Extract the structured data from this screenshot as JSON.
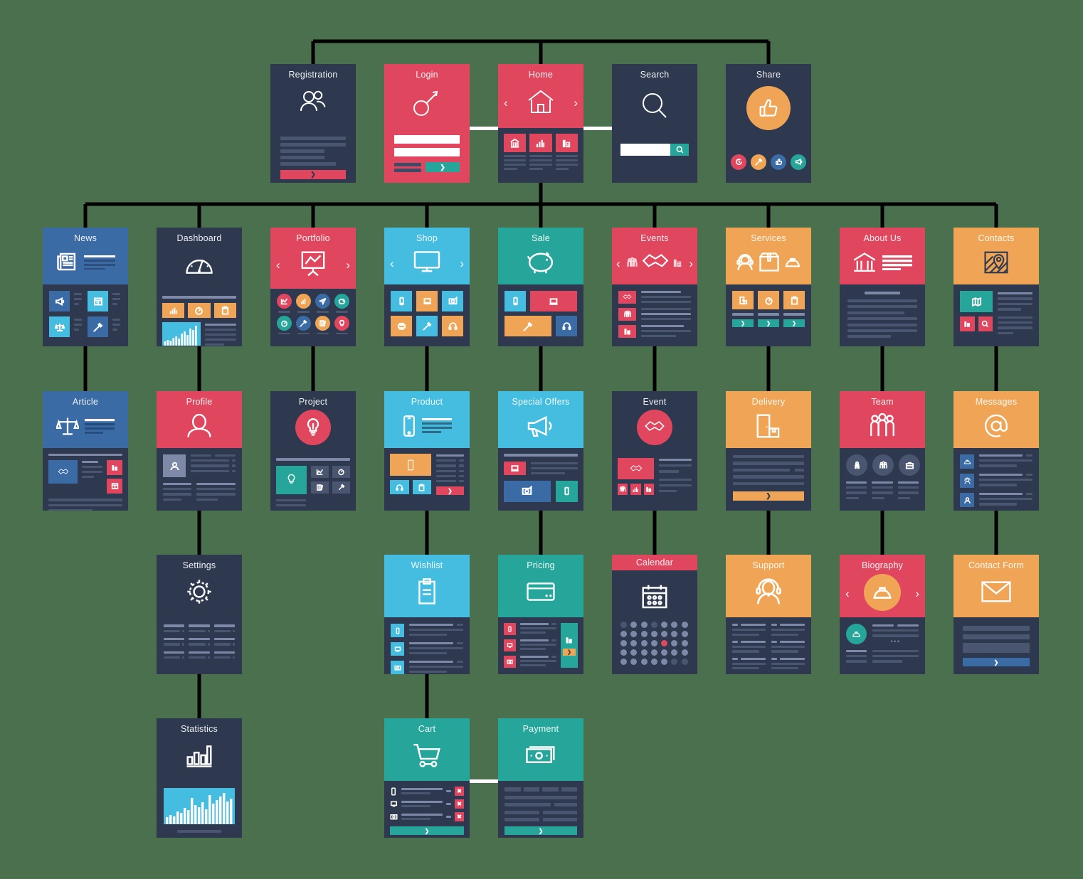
{
  "diagram": {
    "type": "sitemap",
    "background_color": "#4a704d",
    "connector_color": "#000000",
    "white_connector_color": "#ffffff",
    "palette": {
      "dark_navy": "#2e3950",
      "red": "#e0475e",
      "blue": "#3a6ba5",
      "light_blue": "#45bde0",
      "teal": "#26a69a",
      "orange": "#efa555",
      "body_navy": "#2e3950",
      "bar": "#4a5570",
      "bar_light": "#7d89a6"
    }
  },
  "rows": [
    {
      "name": "row-1",
      "cards": [
        {
          "id": "registration",
          "label": "Registration",
          "header_color": "#2e3950",
          "icon": "users-icon",
          "body": "text-lines-with-red-button",
          "button_color": "#e0475e",
          "button_glyph": "❯"
        },
        {
          "id": "login",
          "label": "Login",
          "header_color": "#e0475e",
          "icon": "key-icon",
          "body": "two-white-input-fields-and-teal-submit",
          "button_color": "#26a69a",
          "button_glyph": "❯"
        },
        {
          "id": "home",
          "label": "Home",
          "header_color": "#e0475e",
          "icon": "house-icon",
          "arrows": true,
          "body": "three-red-tiles-with-text",
          "tiles": [
            "bank-icon",
            "bar-chart-icon",
            "building-icon"
          ]
        },
        {
          "id": "search",
          "label": "Search",
          "header_color": "#2e3950",
          "icon": "magnifier-icon",
          "body": "white-search-field-with-teal-search-button",
          "button_color": "#26a69a"
        },
        {
          "id": "share",
          "label": "Share",
          "header_color": "#2e3950",
          "icon": "thumbs-up-icon",
          "icon_circle_color": "#efa555",
          "social": [
            {
              "name": "clock-icon",
              "color": "#e0475e"
            },
            {
              "name": "pen-icon",
              "color": "#efa555"
            },
            {
              "name": "thumbs-up-icon",
              "color": "#3a6ba5"
            },
            {
              "name": "megaphone-icon",
              "color": "#26a69a"
            }
          ]
        }
      ]
    },
    {
      "name": "row-2",
      "cards": [
        {
          "id": "news",
          "label": "News",
          "header_color": "#3a6ba5",
          "icon": "newspaper-icon",
          "body": "four-tiles-with-text-lines",
          "tiles": [
            {
              "name": "megaphone-icon",
              "color": "#3a6ba5"
            },
            {
              "name": "layout-icon",
              "color": "#45bde0"
            },
            {
              "name": "scales-icon",
              "color": "#45bde0"
            },
            {
              "name": "pen-icon",
              "color": "#3a6ba5"
            }
          ]
        },
        {
          "id": "dashboard",
          "label": "Dashboard",
          "header_color": "#2e3950",
          "icon": "gauge-icon",
          "body": "three-orange-tiles-and-chart",
          "tiles": [
            {
              "name": "bar-chart-icon",
              "color": "#efa555"
            },
            {
              "name": "compass-icon",
              "color": "#efa555"
            },
            {
              "name": "clipboard-icon",
              "color": "#efa555"
            }
          ],
          "chart_color": "#45bde0"
        },
        {
          "id": "portfolio",
          "label": "Portfolio",
          "header_color": "#e0475e",
          "icon": "presentation-chart-icon",
          "arrows": true,
          "body": "eight-circle-icons",
          "circles": [
            {
              "name": "chart-icon",
              "color": "#e0475e"
            },
            {
              "name": "bar-chart-icon",
              "color": "#efa555"
            },
            {
              "name": "paper-plane-icon",
              "color": "#3a6ba5"
            },
            {
              "name": "piggy-bank-icon",
              "color": "#26a69a"
            },
            {
              "name": "compass-icon",
              "color": "#26a69a"
            },
            {
              "name": "pen-icon",
              "color": "#3a6ba5"
            },
            {
              "name": "books-icon",
              "color": "#efa555"
            },
            {
              "name": "bulb-icon",
              "color": "#e0475e"
            }
          ]
        },
        {
          "id": "shop",
          "label": "Shop",
          "header_color": "#45bde0",
          "icon": "monitor-icon",
          "arrows": true,
          "body": "six-product-tiles",
          "tiles": [
            {
              "name": "phone-icon",
              "color": "#45bde0"
            },
            {
              "name": "laptop-icon",
              "color": "#efa555"
            },
            {
              "name": "camera-icon",
              "color": "#45bde0"
            },
            {
              "name": "printer-icon",
              "color": "#efa555"
            },
            {
              "name": "pen-icon",
              "color": "#45bde0"
            },
            {
              "name": "headphones-icon",
              "color": "#efa555"
            }
          ]
        },
        {
          "id": "sale",
          "label": "Sale",
          "header_color": "#26a69a",
          "icon": "piggy-bank-icon",
          "body": "four-sale-tiles",
          "tiles": [
            {
              "name": "phone-icon",
              "color": "#45bde0"
            },
            {
              "name": "laptop-icon",
              "color": "#e0475e"
            },
            {
              "name": "pen-icon",
              "color": "#efa555"
            },
            {
              "name": "headphones-icon",
              "color": "#3a6ba5"
            }
          ]
        },
        {
          "id": "events",
          "label": "Events",
          "header_color": "#e0475e",
          "icon": "handshake-icon",
          "arrows": true,
          "header_extra_icons": [
            "group-icon",
            "building-icon"
          ],
          "body": "three-red-thumbs-with-lines",
          "tiles": [
            {
              "name": "handshake-icon",
              "color": "#e0475e"
            },
            {
              "name": "group-icon",
              "color": "#e0475e"
            },
            {
              "name": "building-icon",
              "color": "#e0475e"
            }
          ]
        },
        {
          "id": "services",
          "label": "Services",
          "header_color": "#efa555",
          "header_icons": [
            "headset-icon",
            "box-icon",
            "helmet-icon"
          ],
          "body": "three-orange-tiles-with-teal-buttons",
          "tiles": [
            {
              "name": "door-box-icon",
              "color": "#efa555"
            },
            {
              "name": "compass-icon",
              "color": "#efa555"
            },
            {
              "name": "clipboard-icon",
              "color": "#efa555"
            }
          ],
          "button_color": "#26a69a",
          "button_glyph": "❯"
        },
        {
          "id": "about-us",
          "label": "About Us",
          "header_color": "#e0475e",
          "header_icons": [
            "bank-icon",
            "text-lines-icon"
          ],
          "body": "paragraph-lines"
        },
        {
          "id": "contacts",
          "label": "Contacts",
          "header_color": "#efa555",
          "icon": "map-pin-icon",
          "body": "map-tile-and-two-red-tiles",
          "tiles": [
            {
              "name": "map-icon",
              "color": "#26a69a"
            },
            {
              "name": "building-icon",
              "color": "#e0475e"
            },
            {
              "name": "magnifier-icon",
              "color": "#e0475e"
            }
          ]
        }
      ]
    },
    {
      "name": "row-3",
      "cards": [
        {
          "id": "article",
          "label": "Article",
          "header_color": "#3a6ba5",
          "header_icons": [
            "scales-icon",
            "text-lines-icon"
          ],
          "body": "image-tile-with-two-red-tiles",
          "tiles": [
            {
              "name": "handshake-icon",
              "color": "#3a6ba5"
            },
            {
              "name": "building-icon",
              "color": "#e0475e"
            },
            {
              "name": "layout-icon",
              "color": "#e0475e"
            }
          ]
        },
        {
          "id": "profile",
          "label": "Profile",
          "header_color": "#e0475e",
          "icon": "person-icon",
          "body": "avatar-with-text-lines",
          "tiles": [
            {
              "name": "person-icon",
              "color": "#7d89a6"
            }
          ]
        },
        {
          "id": "project",
          "label": "Project",
          "header_color": "#2e3950",
          "icon": "bulb-icon",
          "icon_circle_color": "#e0475e",
          "body": "four-tiles-with-lines",
          "tiles": [
            {
              "name": "bulb-icon",
              "color": "#26a69a"
            },
            {
              "name": "chart-icon",
              "color": "#4a5570"
            },
            {
              "name": "books-icon",
              "color": "#4a5570"
            },
            {
              "name": "pen-icon",
              "color": "#4a5570"
            }
          ]
        },
        {
          "id": "product",
          "label": "Product",
          "header_color": "#45bde0",
          "header_icons": [
            "phone-icon",
            "text-lines-icon"
          ],
          "body": "orange-image-tile-with-spec-list",
          "tiles": [
            {
              "name": "phone-icon",
              "color": "#efa555"
            },
            {
              "name": "headphones-icon",
              "color": "#45bde0"
            },
            {
              "name": "clipboard-icon",
              "color": "#45bde0"
            }
          ],
          "button_color": "#e0475e",
          "button_glyph": "❯"
        },
        {
          "id": "special-offers",
          "label": "Special Offers",
          "header_color": "#45bde0",
          "icon": "megaphone-icon",
          "body": "offer-tiles",
          "tiles": [
            {
              "name": "laptop-icon",
              "color": "#e0475e"
            },
            {
              "name": "camera-icon",
              "color": "#3a6ba5"
            },
            {
              "name": "phone-icon",
              "color": "#26a69a"
            }
          ]
        },
        {
          "id": "event",
          "label": "Event",
          "header_color": "#2e3950",
          "icon": "handshake-icon",
          "icon_circle_color": "#e0475e",
          "body": "red-image-with-lines-and-three-small-tiles",
          "tiles": [
            {
              "name": "handshake-icon",
              "color": "#e0475e"
            },
            {
              "name": "group-icon",
              "color": "#e0475e"
            },
            {
              "name": "bar-chart-icon",
              "color": "#e0475e"
            },
            {
              "name": "building-icon",
              "color": "#e0475e"
            }
          ]
        },
        {
          "id": "delivery",
          "label": "Delivery",
          "header_color": "#efa555",
          "icon": "delivery-door-icon",
          "body": "text-lines-with-orange-button",
          "button_color": "#efa555",
          "button_glyph": "❯"
        },
        {
          "id": "team",
          "label": "Team",
          "header_color": "#e0475e",
          "icon": "group-icon",
          "body": "three-circle-avatars-with-lines",
          "circles": [
            {
              "name": "tie-person-icon",
              "color": "#4a5570"
            },
            {
              "name": "group-icon",
              "color": "#4a5570"
            },
            {
              "name": "briefcase-icon",
              "color": "#4a5570"
            }
          ]
        },
        {
          "id": "messages",
          "label": "Messages",
          "header_color": "#efa555",
          "icon": "at-sign-icon",
          "body": "three-message-rows",
          "tiles": [
            {
              "name": "helmet-icon",
              "color": "#3a6ba5"
            },
            {
              "name": "headset-icon",
              "color": "#3a6ba5"
            },
            {
              "name": "person-icon",
              "color": "#3a6ba5"
            }
          ]
        }
      ]
    },
    {
      "name": "row-4",
      "cards": [
        {
          "id": "settings",
          "label": "Settings",
          "header_color": "#2e3950",
          "icon": "gear-icon",
          "body": "three-column-settings-lines"
        },
        {
          "id": "wishlist",
          "label": "Wishlist",
          "header_color": "#45bde0",
          "icon": "clipboard-icon",
          "body": "three-wish-rows",
          "tiles": [
            {
              "name": "phone-icon",
              "color": "#45bde0"
            },
            {
              "name": "monitor-icon",
              "color": "#45bde0"
            },
            {
              "name": "camera-icon",
              "color": "#45bde0"
            }
          ]
        },
        {
          "id": "pricing",
          "label": "Pricing",
          "header_color": "#26a69a",
          "icon": "credit-card-icon",
          "body": "three-price-rows-with-teal-panel",
          "tiles": [
            {
              "name": "phone-icon",
              "color": "#e0475e"
            },
            {
              "name": "monitor-icon",
              "color": "#e0475e"
            },
            {
              "name": "camera-icon",
              "color": "#e0475e"
            },
            {
              "name": "building-icon",
              "color": "#26a69a"
            }
          ],
          "button_color": "#efa555",
          "button_glyph": "❯"
        },
        {
          "id": "calendar",
          "label": "Calendar",
          "header_color": "#e0475e",
          "icon": "calendar-icon",
          "body": "dot-grid-calendar",
          "highlight_color": "#e0475e",
          "grid_rows": 5,
          "grid_cols": 7,
          "highlight_index": 24
        },
        {
          "id": "support",
          "label": "Support",
          "header_color": "#efa555",
          "icon": "headset-icon",
          "body": "two-column-faq-lines"
        },
        {
          "id": "biography",
          "label": "Biography",
          "header_color": "#e0475e",
          "icon": "helmet-icon",
          "icon_circle_color": "#efa555",
          "arrows": true,
          "body": "teal-avatar-with-text",
          "circles": [
            {
              "name": "helmet-icon",
              "color": "#26a69a"
            }
          ]
        },
        {
          "id": "contact-form",
          "label": "Contact Form",
          "header_color": "#efa555",
          "icon": "envelope-icon",
          "body": "form-fields-with-blue-submit",
          "button_color": "#3a6ba5",
          "button_glyph": "❯"
        }
      ]
    },
    {
      "name": "row-5",
      "cards": [
        {
          "id": "statistics",
          "label": "Statistics",
          "header_color": "#2e3950",
          "icon": "bar-chart-icon",
          "body": "large-blue-bar-chart",
          "chart_color": "#45bde0"
        },
        {
          "id": "cart",
          "label": "Cart",
          "header_color": "#26a69a",
          "icon": "cart-icon",
          "body": "three-cart-rows-with-delete-buttons",
          "tiles": [
            {
              "name": "phone-icon",
              "color": "#2e3950"
            },
            {
              "name": "monitor-icon",
              "color": "#2e3950"
            },
            {
              "name": "camera-icon",
              "color": "#2e3950"
            }
          ],
          "delete_color": "#e0475e",
          "delete_glyph": "✖",
          "button_color": "#26a69a",
          "button_glyph": "❯"
        },
        {
          "id": "payment",
          "label": "Payment",
          "header_color": "#26a69a",
          "icon": "banknote-icon",
          "body": "payment-fields-with-teal-button",
          "button_color": "#26a69a",
          "button_glyph": "❯"
        }
      ]
    }
  ]
}
